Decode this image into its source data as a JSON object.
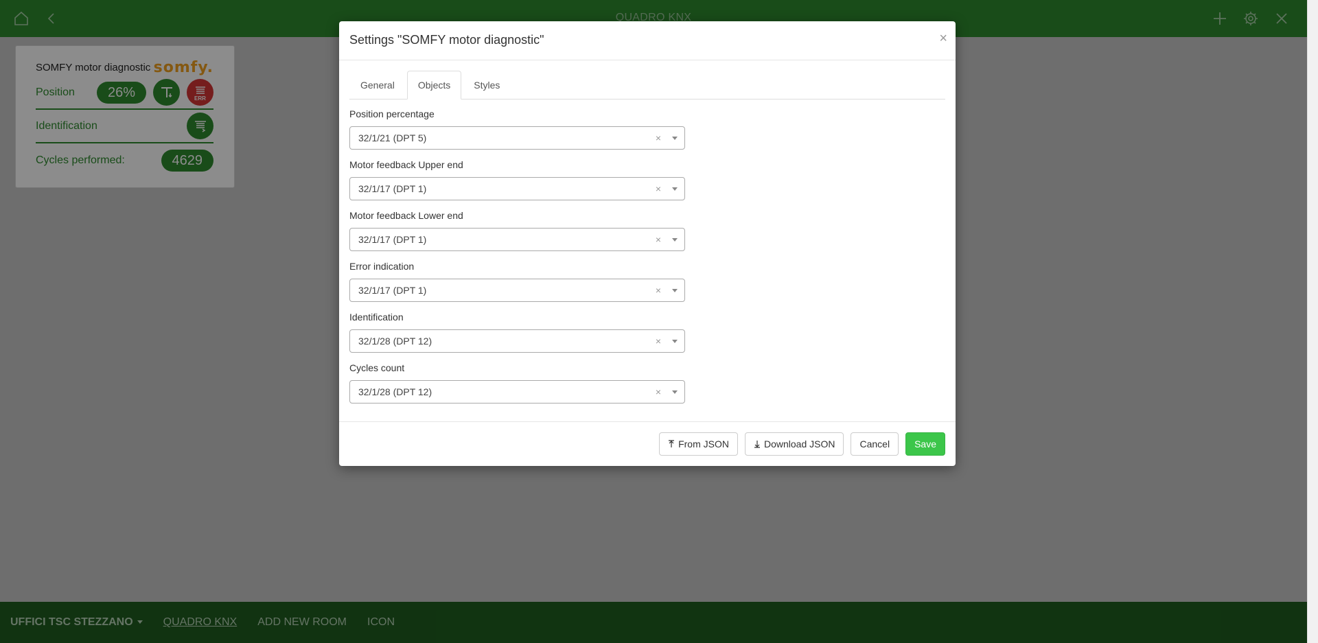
{
  "topbar": {
    "title": "QUADRO KNX",
    "home_icon": "home-icon",
    "back_icon": "back-chevron-icon",
    "add_icon": "plus-icon",
    "settings_icon": "gear-icon",
    "close_icon": "close-icon"
  },
  "widget": {
    "title": "SOMFY motor diagnostic",
    "logo_text": "somfy.",
    "rows": {
      "position": {
        "label": "Position",
        "value": "26%",
        "error_badge": "ERR"
      },
      "identification": {
        "label": "Identification"
      },
      "cycles": {
        "label": "Cycles performed:",
        "value": "4629"
      }
    }
  },
  "modal": {
    "title": "Settings \"SOMFY motor diagnostic\"",
    "close_symbol": "×",
    "tabs": [
      {
        "label": "General"
      },
      {
        "label": "Objects"
      },
      {
        "label": "Styles"
      }
    ],
    "active_tab": "Objects",
    "fields": [
      {
        "label": "Position percentage",
        "value": "32/1/21 (DPT 5)"
      },
      {
        "label": "Motor feedback Upper end",
        "value": "32/1/17 (DPT 1)"
      },
      {
        "label": "Motor feedback Lower end",
        "value": "32/1/17 (DPT 1)"
      },
      {
        "label": "Error indication",
        "value": "32/1/17 (DPT 1)"
      },
      {
        "label": "Identification",
        "value": "32/1/28 (DPT 12)"
      },
      {
        "label": "Cycles count",
        "value": "32/1/28 (DPT 12)"
      }
    ],
    "clear_symbol": "×",
    "buttons": {
      "from_json": "From JSON",
      "download_json": "Download JSON",
      "cancel": "Cancel",
      "save": "Save"
    }
  },
  "bottombar": {
    "items": [
      {
        "label": "UFFICI TSC STEZZANO"
      },
      {
        "label": "QUADRO KNX"
      },
      {
        "label": "ADD NEW ROOM"
      },
      {
        "label": "ICON"
      }
    ]
  },
  "colors": {
    "header_green": "#2e8b2e",
    "footer_green": "#1f5e1f",
    "save_green": "#3cc64a",
    "error_red": "#d63535",
    "somfy_orange": "#f0a020"
  }
}
